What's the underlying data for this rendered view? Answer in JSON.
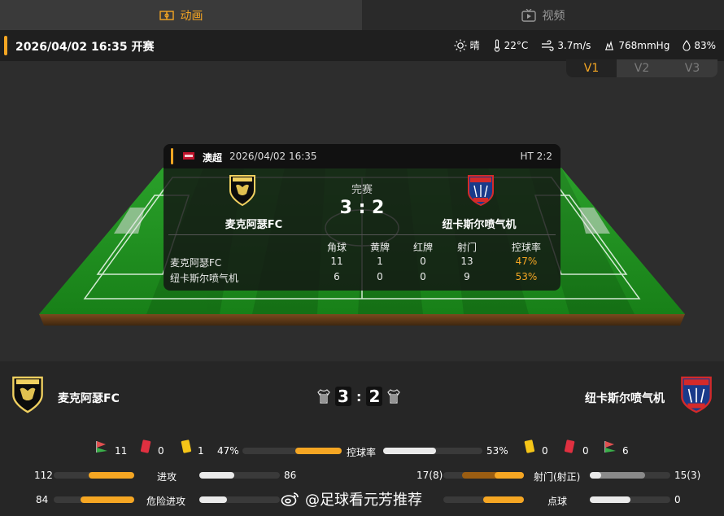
{
  "tabs": {
    "animation": "动画",
    "video": "视频"
  },
  "info": {
    "datetime": "2026/04/02 16:35 开赛",
    "weather": "晴",
    "temperature": "22°C",
    "wind": "3.7m/s",
    "pressure": "768mmHg",
    "humidity": "83%"
  },
  "views": [
    "V1",
    "V2",
    "V3"
  ],
  "card": {
    "league": "澳超",
    "datetime": "2026/04/02 16:35",
    "halftime": "HT 2:2",
    "status": "完赛",
    "score": "3 : 2",
    "home": "麦克阿瑟FC",
    "away": "纽卡斯尔喷气机",
    "columns": [
      "角球",
      "黄牌",
      "红牌",
      "射门",
      "控球率"
    ],
    "rows": [
      {
        "team": "麦克阿瑟FC",
        "values": [
          "11",
          "1",
          "0",
          "13",
          "47%"
        ]
      },
      {
        "team": "纽卡斯尔喷气机",
        "values": [
          "6",
          "0",
          "0",
          "9",
          "53%"
        ]
      }
    ]
  },
  "crests": {
    "home_text": "MACARTHUR FC",
    "away_text": "NEWCASTLE UNITED JETS"
  },
  "scoreboard": {
    "home": "麦克阿瑟FC",
    "away": "纽卡斯尔喷气机",
    "home_score": "3",
    "away_score": "2"
  },
  "stats": {
    "home_corners": "11",
    "home_red": "0",
    "home_yellow": "1",
    "away_yellow": "0",
    "away_red": "0",
    "away_corners": "6",
    "possession": {
      "label": "控球率",
      "home": "47%",
      "away": "53%",
      "home_fraction": 0.47,
      "away_fraction": 0.53
    },
    "attacks": {
      "label": "进攻",
      "home": "112",
      "away": "86"
    },
    "dangerous": {
      "label": "危险进攻",
      "home": "84",
      "away": ""
    },
    "shots": {
      "label": "射门(射正)",
      "home": "17(8)",
      "away": "15(3)"
    },
    "penalty": {
      "label": "点球",
      "home": "",
      "away": "0"
    }
  },
  "watermark": "@足球看元芳推荐",
  "colors": {
    "accent": "#f5a623",
    "pitch": "#1f8a1f"
  }
}
